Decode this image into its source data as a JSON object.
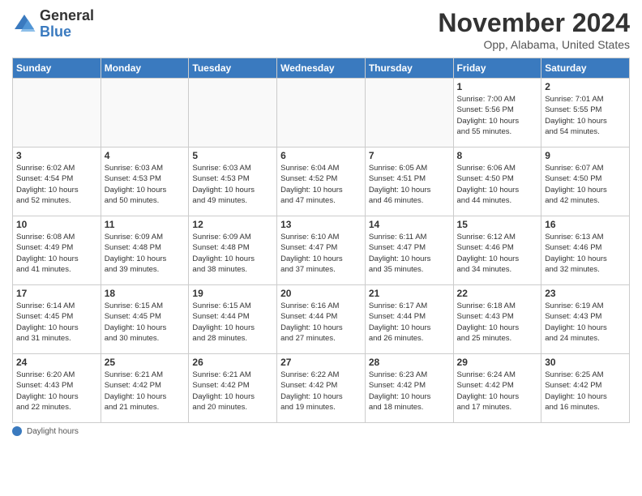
{
  "header": {
    "logo_line1": "General",
    "logo_line2": "Blue",
    "month_title": "November 2024",
    "location": "Opp, Alabama, United States"
  },
  "weekdays": [
    "Sunday",
    "Monday",
    "Tuesday",
    "Wednesday",
    "Thursday",
    "Friday",
    "Saturday"
  ],
  "weeks": [
    [
      {
        "day": "",
        "info": ""
      },
      {
        "day": "",
        "info": ""
      },
      {
        "day": "",
        "info": ""
      },
      {
        "day": "",
        "info": ""
      },
      {
        "day": "",
        "info": ""
      },
      {
        "day": "1",
        "info": "Sunrise: 7:00 AM\nSunset: 5:56 PM\nDaylight: 10 hours\nand 55 minutes."
      },
      {
        "day": "2",
        "info": "Sunrise: 7:01 AM\nSunset: 5:55 PM\nDaylight: 10 hours\nand 54 minutes."
      }
    ],
    [
      {
        "day": "3",
        "info": "Sunrise: 6:02 AM\nSunset: 4:54 PM\nDaylight: 10 hours\nand 52 minutes."
      },
      {
        "day": "4",
        "info": "Sunrise: 6:03 AM\nSunset: 4:53 PM\nDaylight: 10 hours\nand 50 minutes."
      },
      {
        "day": "5",
        "info": "Sunrise: 6:03 AM\nSunset: 4:53 PM\nDaylight: 10 hours\nand 49 minutes."
      },
      {
        "day": "6",
        "info": "Sunrise: 6:04 AM\nSunset: 4:52 PM\nDaylight: 10 hours\nand 47 minutes."
      },
      {
        "day": "7",
        "info": "Sunrise: 6:05 AM\nSunset: 4:51 PM\nDaylight: 10 hours\nand 46 minutes."
      },
      {
        "day": "8",
        "info": "Sunrise: 6:06 AM\nSunset: 4:50 PM\nDaylight: 10 hours\nand 44 minutes."
      },
      {
        "day": "9",
        "info": "Sunrise: 6:07 AM\nSunset: 4:50 PM\nDaylight: 10 hours\nand 42 minutes."
      }
    ],
    [
      {
        "day": "10",
        "info": "Sunrise: 6:08 AM\nSunset: 4:49 PM\nDaylight: 10 hours\nand 41 minutes."
      },
      {
        "day": "11",
        "info": "Sunrise: 6:09 AM\nSunset: 4:48 PM\nDaylight: 10 hours\nand 39 minutes."
      },
      {
        "day": "12",
        "info": "Sunrise: 6:09 AM\nSunset: 4:48 PM\nDaylight: 10 hours\nand 38 minutes."
      },
      {
        "day": "13",
        "info": "Sunrise: 6:10 AM\nSunset: 4:47 PM\nDaylight: 10 hours\nand 37 minutes."
      },
      {
        "day": "14",
        "info": "Sunrise: 6:11 AM\nSunset: 4:47 PM\nDaylight: 10 hours\nand 35 minutes."
      },
      {
        "day": "15",
        "info": "Sunrise: 6:12 AM\nSunset: 4:46 PM\nDaylight: 10 hours\nand 34 minutes."
      },
      {
        "day": "16",
        "info": "Sunrise: 6:13 AM\nSunset: 4:46 PM\nDaylight: 10 hours\nand 32 minutes."
      }
    ],
    [
      {
        "day": "17",
        "info": "Sunrise: 6:14 AM\nSunset: 4:45 PM\nDaylight: 10 hours\nand 31 minutes."
      },
      {
        "day": "18",
        "info": "Sunrise: 6:15 AM\nSunset: 4:45 PM\nDaylight: 10 hours\nand 30 minutes."
      },
      {
        "day": "19",
        "info": "Sunrise: 6:15 AM\nSunset: 4:44 PM\nDaylight: 10 hours\nand 28 minutes."
      },
      {
        "day": "20",
        "info": "Sunrise: 6:16 AM\nSunset: 4:44 PM\nDaylight: 10 hours\nand 27 minutes."
      },
      {
        "day": "21",
        "info": "Sunrise: 6:17 AM\nSunset: 4:44 PM\nDaylight: 10 hours\nand 26 minutes."
      },
      {
        "day": "22",
        "info": "Sunrise: 6:18 AM\nSunset: 4:43 PM\nDaylight: 10 hours\nand 25 minutes."
      },
      {
        "day": "23",
        "info": "Sunrise: 6:19 AM\nSunset: 4:43 PM\nDaylight: 10 hours\nand 24 minutes."
      }
    ],
    [
      {
        "day": "24",
        "info": "Sunrise: 6:20 AM\nSunset: 4:43 PM\nDaylight: 10 hours\nand 22 minutes."
      },
      {
        "day": "25",
        "info": "Sunrise: 6:21 AM\nSunset: 4:42 PM\nDaylight: 10 hours\nand 21 minutes."
      },
      {
        "day": "26",
        "info": "Sunrise: 6:21 AM\nSunset: 4:42 PM\nDaylight: 10 hours\nand 20 minutes."
      },
      {
        "day": "27",
        "info": "Sunrise: 6:22 AM\nSunset: 4:42 PM\nDaylight: 10 hours\nand 19 minutes."
      },
      {
        "day": "28",
        "info": "Sunrise: 6:23 AM\nSunset: 4:42 PM\nDaylight: 10 hours\nand 18 minutes."
      },
      {
        "day": "29",
        "info": "Sunrise: 6:24 AM\nSunset: 4:42 PM\nDaylight: 10 hours\nand 17 minutes."
      },
      {
        "day": "30",
        "info": "Sunrise: 6:25 AM\nSunset: 4:42 PM\nDaylight: 10 hours\nand 16 minutes."
      }
    ]
  ],
  "footer": {
    "label": "Daylight hours"
  }
}
